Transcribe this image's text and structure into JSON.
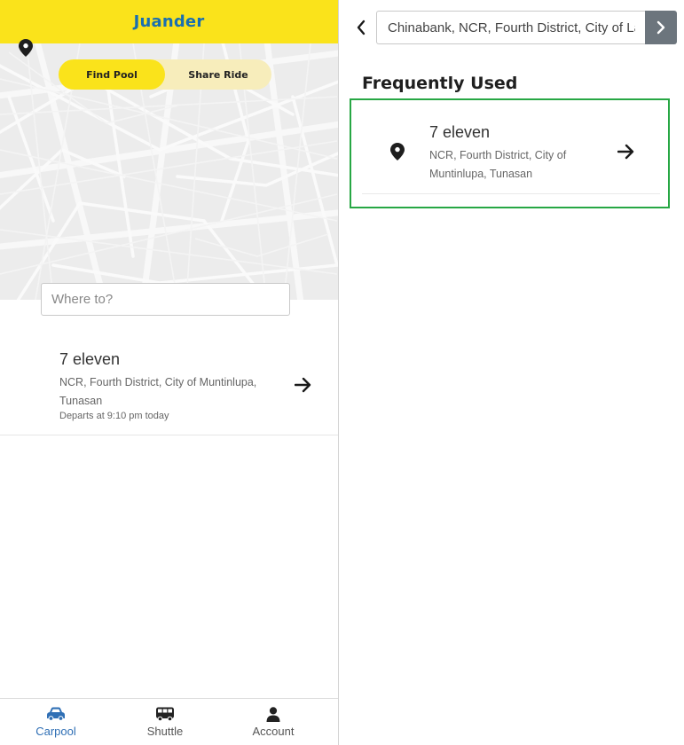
{
  "left": {
    "app_title": "Juander",
    "toggle": {
      "find_pool": "Find Pool",
      "share_ride": "Share Ride",
      "active": "find_pool"
    },
    "search": {
      "placeholder": "Where to?",
      "value": ""
    },
    "trip": {
      "title": "7 eleven",
      "address": "NCR, Fourth District, City of Muntinlupa, Tunasan",
      "departs": "Departs at 9:10 pm today",
      "icon": "location-pin-icon",
      "action_icon": "arrow-right-icon"
    },
    "nav": {
      "items": [
        {
          "label": "Carpool",
          "icon": "car-icon",
          "active": true
        },
        {
          "label": "Shuttle",
          "icon": "bus-icon",
          "active": false
        },
        {
          "label": "Account",
          "icon": "person-icon",
          "active": false
        }
      ]
    }
  },
  "right": {
    "search": {
      "value": "Chinabank, NCR, Fourth District, City of Las"
    },
    "section_title": "Frequently Used",
    "favorites": [
      {
        "title": "7 eleven",
        "address": "NCR, Fourth District, City of Muntinlupa, Tunasan",
        "icon": "location-pin-icon",
        "action_icon": "arrow-right-icon"
      }
    ]
  },
  "colors": {
    "brand_yellow": "#FAE31B",
    "toggle_track": "#f7edbb",
    "title_blue": "#1a6fb0",
    "active_nav": "#2f6fb5",
    "highlight_green": "#27a744",
    "go_button": "#6c757d"
  }
}
